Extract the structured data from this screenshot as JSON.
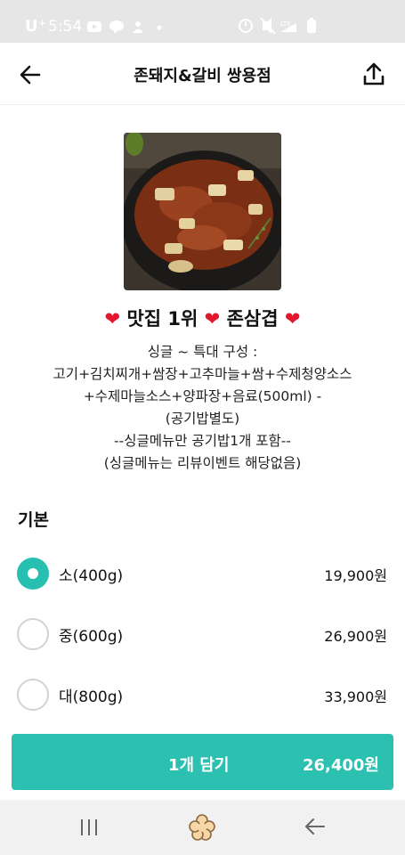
{
  "status_bar": {
    "carrier": "U⁺",
    "time": "5:54",
    "network": "LTE"
  },
  "header": {
    "title": "존돼지&갈비 쌍용점",
    "back_icon": "arrow-left-icon",
    "share_icon": "share-upload-icon"
  },
  "menu": {
    "image": "pork-kimchi-dish-photo",
    "title_a": "맛집 1위",
    "title_b": "존삼겹",
    "heart_color": "#e3162b",
    "description": [
      "싱글 ~ 특대 구성 :",
      "고기+김치찌개+쌈장+고추마늘+쌈+수제청양소스",
      "+수제마늘소스+양파장+음료(500ml) -",
      "(공기밥별도)",
      "--싱글메뉴만 공기밥1개 포함--",
      "(싱글메뉴는 리뷰이벤트 해당없음)"
    ]
  },
  "options_section": {
    "title": "기본",
    "selected_index": 0,
    "items": [
      {
        "label": "소(400g)",
        "price": "19,900원"
      },
      {
        "label": "중(600g)",
        "price": "26,900원"
      },
      {
        "label": "대(800g)",
        "price": "33,900원"
      }
    ]
  },
  "cart_button": {
    "quantity_label": "1개 담기",
    "total": "26,400원",
    "color": "#2cc0b0"
  },
  "nav_bar": {
    "icons": [
      "recent-apps-icon",
      "home-icon",
      "back-icon"
    ]
  }
}
